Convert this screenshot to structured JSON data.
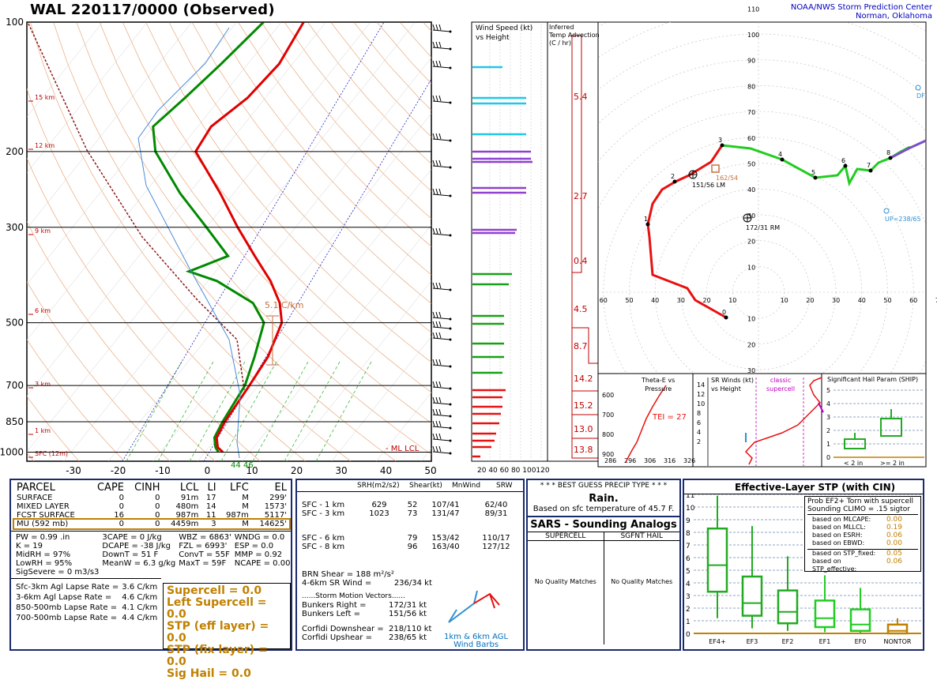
{
  "title": "WAL   220117/0000  (Observed)",
  "credit": [
    "NOAA/NWS Storm Prediction Center",
    "Norman, Oklahoma"
  ],
  "skewt": {
    "pressure_labels": [
      "100",
      "200",
      "300",
      "500",
      "700",
      "850",
      "1000"
    ],
    "temp_labels": [
      "-30",
      "-20",
      "-10",
      "0",
      "10",
      "20",
      "30",
      "40",
      "50"
    ],
    "height_labels": [
      "15 km",
      "12 km",
      "9 km",
      "6 km",
      "3 km",
      "1 km",
      "SFC (12m)"
    ],
    "lapse_label": "5.1 C/km",
    "lcl_label": "- ML LCL",
    "sfc_values": "44  46"
  },
  "wind_panel": {
    "title": [
      "Wind Speed (kt)",
      "vs Height"
    ],
    "axis": "20 40 60 80 100120"
  },
  "temp_adv": {
    "title": [
      "Inferred",
      "Temp Advection",
      "(C / hr)"
    ],
    "values": [
      "5.4",
      "2.7",
      "0.4",
      "4.5",
      "8.7",
      "14.2",
      "15.2",
      "13.0",
      "13.8"
    ]
  },
  "hodograph": {
    "ring_labels_up": [
      "110",
      "100",
      "90",
      "80",
      "70",
      "60",
      "50",
      "40",
      "30",
      "20",
      "10"
    ],
    "ring_labels_down": [
      "10",
      "20",
      "30"
    ],
    "ring_labels_x": [
      "60",
      "50",
      "40",
      "30",
      "20",
      "10",
      "10",
      "20",
      "30",
      "40",
      "50",
      "60",
      "70"
    ],
    "lm_label": "151/56 LM",
    "rm_label": "172/31 RM",
    "storm_label": "162/54",
    "dn_label": "DF",
    "up_label": "UP=238/65",
    "points": [
      "0",
      "1",
      "2",
      "3",
      "4",
      "5",
      "6",
      "7",
      "8"
    ]
  },
  "theta_panel": {
    "title": [
      "Theta-E vs",
      "Pressure"
    ],
    "tei": "TEI = 27",
    "y": [
      "600",
      "700",
      "800",
      "900"
    ],
    "x": [
      "286",
      "296",
      "306",
      "316",
      "326"
    ]
  },
  "sr_panel": {
    "title": [
      "SR Winds (kt)",
      "vs Height"
    ],
    "classic": [
      "classic",
      "supercell"
    ],
    "y": [
      "14",
      "12",
      "10",
      "8",
      "6",
      "4",
      "2"
    ]
  },
  "ship_panel": {
    "title": "Significant Hail Param (SHIP)",
    "y": [
      "5",
      "4",
      "3",
      "2",
      "1",
      "0"
    ],
    "x": [
      "< 2 in",
      ">= 2 in"
    ]
  },
  "parcels": {
    "headers": [
      "PARCEL",
      "CAPE",
      "CINH",
      "LCL",
      "LI",
      "LFC",
      "EL"
    ],
    "rows": [
      [
        "SURFACE",
        "0",
        "0",
        "91m",
        "17",
        "M",
        "299'"
      ],
      [
        "MIXED LAYER",
        "0",
        "0",
        "480m",
        "14",
        "M",
        "1573'"
      ],
      [
        "FCST SURFACE",
        "16",
        "0",
        "987m",
        "11",
        "987m",
        "5117'"
      ],
      [
        "MU   (592 mb)",
        "0",
        "0",
        "4459m",
        "3",
        "M",
        "14625'"
      ]
    ],
    "indices": [
      [
        "PW = 0.99 .in",
        "3CAPE = 0 J/kg",
        "WBZ = 6863'",
        "WNDG = 0.0"
      ],
      [
        "K = 19",
        "DCAPE = -38 J/kg",
        "FZL = 6993'",
        "ESP = 0.0"
      ],
      [
        "MidRH = 97%",
        "DownT = 51 F",
        "ConvT = 55F",
        "MMP = 0.92"
      ],
      [
        "LowRH = 95%",
        "MeanW = 6.3 g/kg",
        "MaxT = 59F",
        "NCAPE = 0.00"
      ],
      [
        "SigSevere = 0 m3/s3",
        "",
        "",
        ""
      ]
    ],
    "lapse": [
      [
        "Sfc-3km Agl Lapse Rate =",
        "3.6 C/km"
      ],
      [
        "3-6km Agl Lapse Rate =",
        "4.6 C/km"
      ],
      [
        "850-500mb Lapse Rate =",
        "4.1 C/km"
      ],
      [
        "700-500mb Lapse Rate =",
        "4.4 C/km"
      ]
    ],
    "composites": [
      "Supercell = 0.0",
      "Left Supercell = 0.0",
      "STP (eff layer) = 0.0",
      "STP (fix layer) = 0.0",
      "Sig Hail = 0.0"
    ]
  },
  "kinematics": {
    "headers": [
      "SRH(m2/s2)",
      "Shear(kt)",
      "MnWind",
      "SRW"
    ],
    "rows": [
      [
        "SFC - 1 km",
        "629",
        "52",
        "107/41",
        "62/40"
      ],
      [
        "SFC - 3 km",
        "1023",
        "73",
        "131/47",
        "89/31"
      ],
      [
        "SFC - 6 km",
        "",
        "79",
        "153/42",
        "110/17"
      ],
      [
        "SFC - 8 km",
        "",
        "96",
        "163/40",
        "127/12"
      ]
    ],
    "brn": "BRN Shear =  188 m²/s²",
    "srwind": "4-6km SR Wind =         236/34 kt",
    "storm_title": "......Storm Motion Vectors......",
    "storm": [
      [
        "Bunkers Right =",
        "172/31 kt"
      ],
      [
        "Bunkers Left =",
        "151/56 kt"
      ],
      [
        "Corfidi Downshear =",
        "218/110 kt"
      ],
      [
        "Corfidi Upshear =",
        "238/65 kt"
      ]
    ],
    "barb_caption": [
      "1km & 6km AGL",
      "Wind Barbs"
    ]
  },
  "precip": {
    "title": "* * * BEST GUESS PRECIP TYPE * * *",
    "type": "Rain.",
    "note": "Based on sfc temperature of 45.7 F."
  },
  "sars": {
    "title": "SARS - Sounding Analogs",
    "cols": [
      "SUPERCELL",
      "SGFNT HAIL"
    ],
    "values": [
      "No Quality Matches",
      "No Quality Matches"
    ]
  },
  "stp": {
    "title": "Effective-Layer STP (with CIN)",
    "prob_title": [
      "Prob EF2+ Torn with supercell",
      "Sounding CLIMO = .15 sigtor"
    ],
    "probs": [
      [
        "based on MLCAPE:",
        "0.00"
      ],
      [
        "based on MLLCL:",
        "0.19"
      ],
      [
        "based on ESRH:",
        "0.06"
      ],
      [
        "based on EBWD:",
        "0.00"
      ],
      [
        "based on STP_fixed:",
        "0.05"
      ],
      [
        "based on STP_effective:",
        "0.06"
      ]
    ],
    "y": [
      "11",
      "10",
      "9",
      "8",
      "7",
      "6",
      "5",
      "4",
      "3",
      "2",
      "1",
      "0"
    ],
    "categories": [
      "EF4+",
      "EF3",
      "EF2",
      "EF1",
      "EF0",
      "NONTOR"
    ]
  },
  "chart_data": [
    {
      "type": "line",
      "title": "WAL   220117/0000  (Observed)",
      "xlabel": "",
      "ylabel": "",
      "y_scale": "log-pressure",
      "ylim": [
        1000,
        100
      ],
      "xlim": [
        -30,
        50
      ],
      "series": [
        {
          "points": [
            [
              1000,
              4.0
            ],
            [
              975,
              2.0
            ],
            [
              925,
              0.0
            ],
            [
              850,
              -1.0
            ],
            [
              700,
              -2.0
            ],
            [
              600,
              -3.0
            ],
            [
              500,
              -6.0
            ],
            [
              450,
              -10.0
            ],
            [
              400,
              -16.0
            ],
            [
              350,
              -24.0
            ],
            [
              300,
              -33.0
            ],
            [
              250,
              -43.0
            ],
            [
              200,
              -56.0
            ],
            [
              175,
              -57.0
            ],
            [
              150,
              -54.0
            ],
            [
              125,
              -53.0
            ],
            [
              100,
              -55.0
            ]
          ]
        },
        {
          "points": [
            [
              1000,
              3.0
            ],
            [
              975,
              1.5
            ],
            [
              925,
              -0.5
            ],
            [
              850,
              -1.5
            ],
            [
              700,
              -3.0
            ],
            [
              600,
              -6.0
            ],
            [
              500,
              -10.0
            ],
            [
              450,
              -16.0
            ],
            [
              400,
              -28.0
            ],
            [
              380,
              -36.0
            ],
            [
              350,
              -30.0
            ],
            [
              300,
              -40.0
            ],
            [
              250,
              -52.0
            ],
            [
              200,
              -65.0
            ],
            [
              175,
              -70.0
            ],
            [
              150,
              -68.0
            ],
            [
              125,
              -66.0
            ],
            [
              100,
              -64.0
            ]
          ]
        }
      ],
      "annotations": [
        "5.1 C/km",
        "- ML LCL",
        "44",
        "46"
      ]
    },
    {
      "type": "scatter",
      "title": "",
      "xlim": [
        -60,
        70
      ],
      "ylim": [
        -30,
        110
      ],
      "series": [
        {
          "points": [
            [
              10,
              8
            ],
            [
              -45,
              23
            ],
            [
              -35,
              46
            ],
            [
              -12,
              62
            ],
            [
              10,
              58
            ],
            [
              25,
              48
            ],
            [
              35,
              50
            ],
            [
              42,
              50
            ],
            [
              52,
              54
            ],
            [
              60,
              58
            ],
            [
              70,
              62
            ]
          ]
        }
      ],
      "annotations": [
        "151/56 LM",
        "172/31 RM",
        "162/54",
        "UP=238/65"
      ]
    },
    {
      "type": "bar",
      "title": "Effective-Layer STP (with CIN)",
      "categories": [
        "EF4+",
        "EF3",
        "EF2",
        "EF1",
        "EF0",
        "NONTOR"
      ],
      "ylim": [
        0,
        11
      ],
      "series": [
        {
          "name": "",
          "values": [
            5.4,
            2.4,
            1.7,
            1.2,
            0.7,
            0.2
          ]
        }
      ]
    }
  ]
}
